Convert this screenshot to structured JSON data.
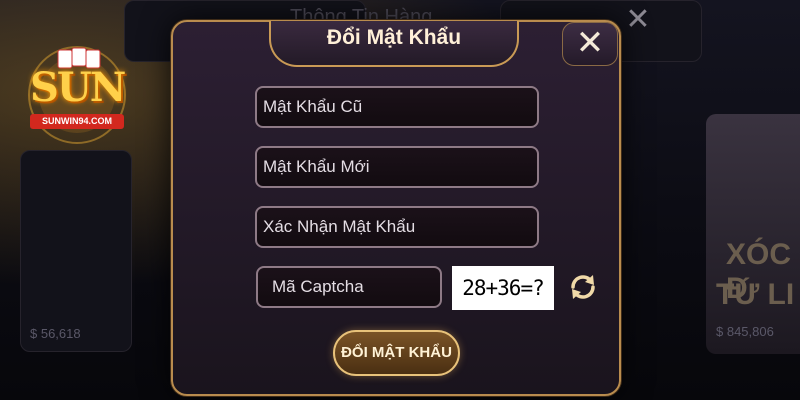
{
  "background": {
    "lobby_title": "Thông Tin Hàng",
    "close_glyph": "✕",
    "side_game_line1": "XÓC Đ",
    "side_game_line2": "TỨ LI",
    "money_left": "$  56,618",
    "money_right": "$  845,806"
  },
  "logo": {
    "word": "SUN",
    "ribbon": "SUNWIN94.COM"
  },
  "modal": {
    "title": "Đổi Mật Khẩu",
    "close_glyph": "✕",
    "fields": {
      "old_password_placeholder": "Mật Khẩu Cũ",
      "new_password_placeholder": "Mật Khẩu Mới",
      "confirm_password_placeholder": "Xác Nhận Mật Khẩu",
      "captcha_placeholder": "Mã Captcha"
    },
    "captcha_text": "28+36=?",
    "refresh_icon": "refresh-icon",
    "submit_label": "ĐỔI MẬT KHẨU"
  },
  "colors": {
    "accent_gold": "#c99a55",
    "modal_bg": "#2c1f33",
    "field_border": "#8e7a86"
  }
}
